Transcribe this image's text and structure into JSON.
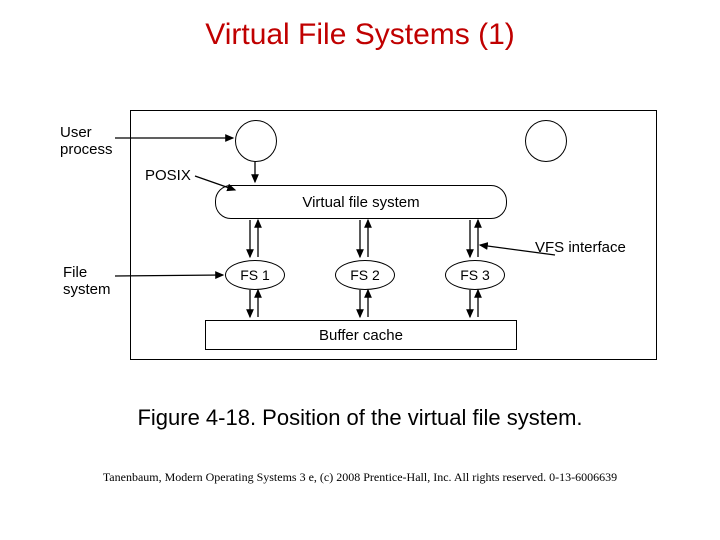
{
  "title": "Virtual File Systems (1)",
  "diagram": {
    "labels": {
      "user_process": "User\nprocess",
      "posix": "POSIX",
      "vfs_interface": "VFS interface",
      "file_system": "File\nsystem"
    },
    "vfs_box": "Virtual file system",
    "fs_nodes": [
      "FS 1",
      "FS 2",
      "FS 3"
    ],
    "buffer_cache": "Buffer cache"
  },
  "caption": "Figure 4-18. Position of the virtual file system.",
  "footer": "Tanenbaum, Modern Operating Systems 3 e, (c) 2008 Prentice-Hall, Inc. All rights reserved. 0-13-6006639"
}
